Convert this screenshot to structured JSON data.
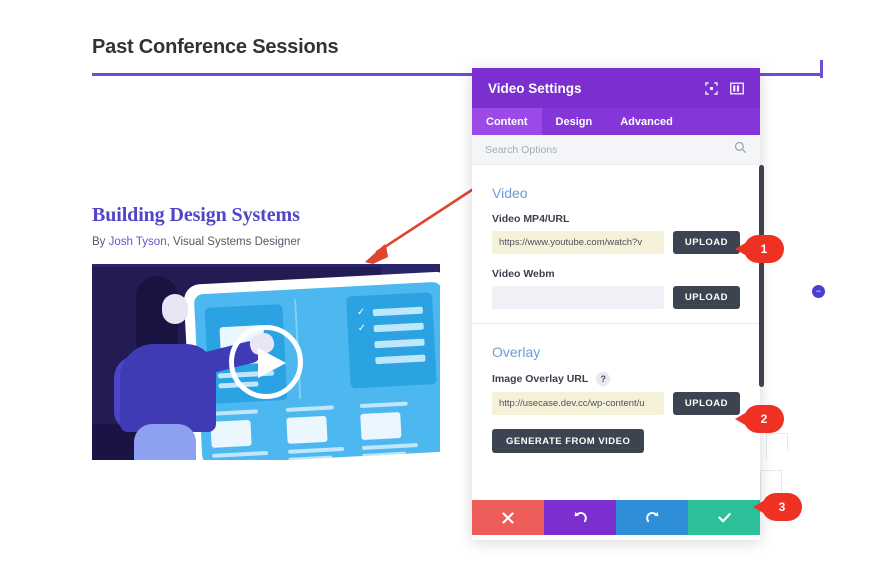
{
  "page": {
    "title": "Past Conference Sessions",
    "article": {
      "title": "Building Design Systems",
      "by_prefix": "By ",
      "author": "Josh Tyson",
      "author_suffix": ", Visual Systems Designer"
    }
  },
  "modal": {
    "title": "Video Settings",
    "header_icons": [
      {
        "name": "expand-icon"
      },
      {
        "name": "layout-panel-icon"
      }
    ],
    "tabs": [
      {
        "label": "Content",
        "active": true
      },
      {
        "label": "Design",
        "active": false
      },
      {
        "label": "Advanced",
        "active": false
      }
    ],
    "search": {
      "placeholder": "Search Options",
      "value": ""
    },
    "sections": [
      {
        "heading": "Video",
        "fields": [
          {
            "label": "Video MP4/URL",
            "value": "https://www.youtube.com/watch?v",
            "modified": true,
            "button": "UPLOAD"
          },
          {
            "label": "Video Webm",
            "value": "",
            "modified": false,
            "button": "UPLOAD"
          }
        ]
      },
      {
        "heading": "Overlay",
        "fields": [
          {
            "label": "Image Overlay URL",
            "help": "?",
            "value": "http://usecase.dev.cc/wp-content/u",
            "modified": true,
            "button": "UPLOAD"
          }
        ],
        "extra_button": "GENERATE FROM VIDEO"
      }
    ],
    "footer": [
      {
        "name": "cancel-button",
        "glyph": "✖",
        "color": "#ec5d5a"
      },
      {
        "name": "undo-button",
        "glyph": "↺",
        "color": "#7b2fcf"
      },
      {
        "name": "redo-button",
        "glyph": "↻",
        "color": "#2e8fd8"
      },
      {
        "name": "save-button",
        "glyph": "✔",
        "color": "#2bbf9a"
      }
    ]
  },
  "annotations": [
    {
      "number": "1"
    },
    {
      "number": "2"
    },
    {
      "number": "3"
    }
  ],
  "colors": {
    "accent_purple": "#7b2fcf",
    "tab_purple": "#8436d9",
    "tab_active": "#9b4ae8",
    "annotation_red": "#ef3124",
    "link_purple": "#6454d0",
    "heading_blue": "#6c9cd6",
    "rule_purple": "#6f4bd8",
    "save_teal": "#2bbf9a"
  }
}
